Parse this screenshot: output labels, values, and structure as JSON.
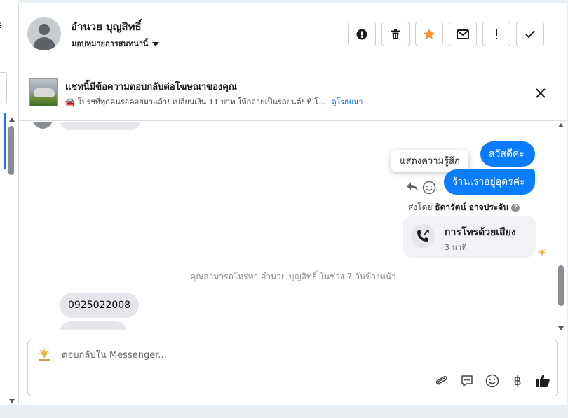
{
  "left_pane": {
    "clipped_text": "s"
  },
  "header": {
    "contact_name": "อำนวย บุญสิทธิ์",
    "assign_label": "มอบหมายการสนทนานี้",
    "actions": [
      {
        "name": "mark-spam-button",
        "icon": "alert-circle-icon"
      },
      {
        "name": "delete-button",
        "icon": "trash-icon"
      },
      {
        "name": "star-button",
        "icon": "star-icon"
      },
      {
        "name": "mark-unread-button",
        "icon": "envelope-icon"
      },
      {
        "name": "follow-up-button",
        "icon": "exclamation-icon"
      },
      {
        "name": "mark-done-button",
        "icon": "check-icon"
      }
    ]
  },
  "banner": {
    "title": "แชทนี้มีข้อความตอบกลับต่อโฆษณาของคุณ",
    "subtitle": "โปรฯที่ทุกคนรอคอยมาแล้ว! เปลี่ยนเงิน 11 บาท ให้กลายเป็นรถยนต์! ที่ โ...",
    "link": "ดูโฆษณา",
    "car_emoji": "🚘"
  },
  "chat": {
    "messages_out": [
      "สวัสดีค่ะ",
      "ร้านเราอยู่อุดรค่ะ"
    ],
    "tooltip": "แสดงความรู้สึก",
    "sent_by_prefix": "ส่งโดย",
    "sent_by_name": "ธิดารัตน์ อาจประจัน",
    "help": "?",
    "call": {
      "title": "การโทรด้วยเสียง",
      "duration": "3 นาที"
    },
    "notice": "คุณสามารถโทรหา อำนวย บุญสิทธิ์ ในช่วง 7 วันข้างหน้า",
    "message_in": "0925022008"
  },
  "composer": {
    "placeholder": "ตอบกลับใน Messenger...",
    "currency_symbol": "฿"
  },
  "colors": {
    "accent": "#0a7cff",
    "star": "#f7923b",
    "link": "#1877f2"
  }
}
